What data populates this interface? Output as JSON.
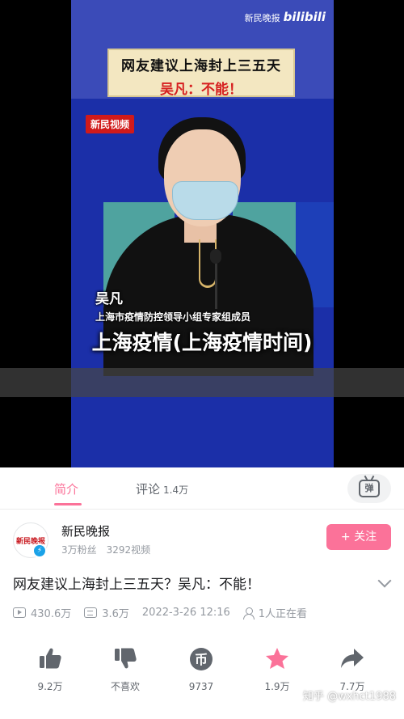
{
  "video": {
    "watermark_channel": "新民晚报",
    "watermark_brand": "bilibili",
    "headline": "网友建议上海封上三五天",
    "subheadline": "吴凡：不能！",
    "news_tag": "新民视频",
    "caption_name": "吴凡",
    "caption_role": "上海市疫情防控领导小组专家组成员",
    "overlay_title": "上海疫情(上海疫情时间)"
  },
  "tabs": [
    {
      "label": "简介"
    },
    {
      "label": "评论",
      "count": "1.4万"
    }
  ],
  "danmaku_toggle": {
    "label": "弹"
  },
  "uploader": {
    "avatar_text": "新民晚报",
    "name": "新民晚报",
    "fans": "3万粉丝",
    "videos": "3292视频",
    "follow_label": "+ 关注"
  },
  "video_info": {
    "title": "网友建议上海封上三五天？吴凡：不能！",
    "views": "430.6万",
    "danmaku": "3.6万",
    "date": "2022-3-26 12:16",
    "watching": "1人正在看"
  },
  "actions": [
    {
      "label": "9.2万",
      "icon": "thumbs-up-icon"
    },
    {
      "label": "不喜欢",
      "icon": "thumbs-down-icon"
    },
    {
      "label": "9737",
      "icon": "coin-icon"
    },
    {
      "label": "1.9万",
      "icon": "star-icon"
    },
    {
      "label": "7.7万",
      "icon": "share-icon"
    }
  ],
  "overlay_watermark": "知乎 @wxhct1988",
  "colors": {
    "accent": "#fb7299",
    "text": "#18191c",
    "muted": "#9499a0"
  }
}
